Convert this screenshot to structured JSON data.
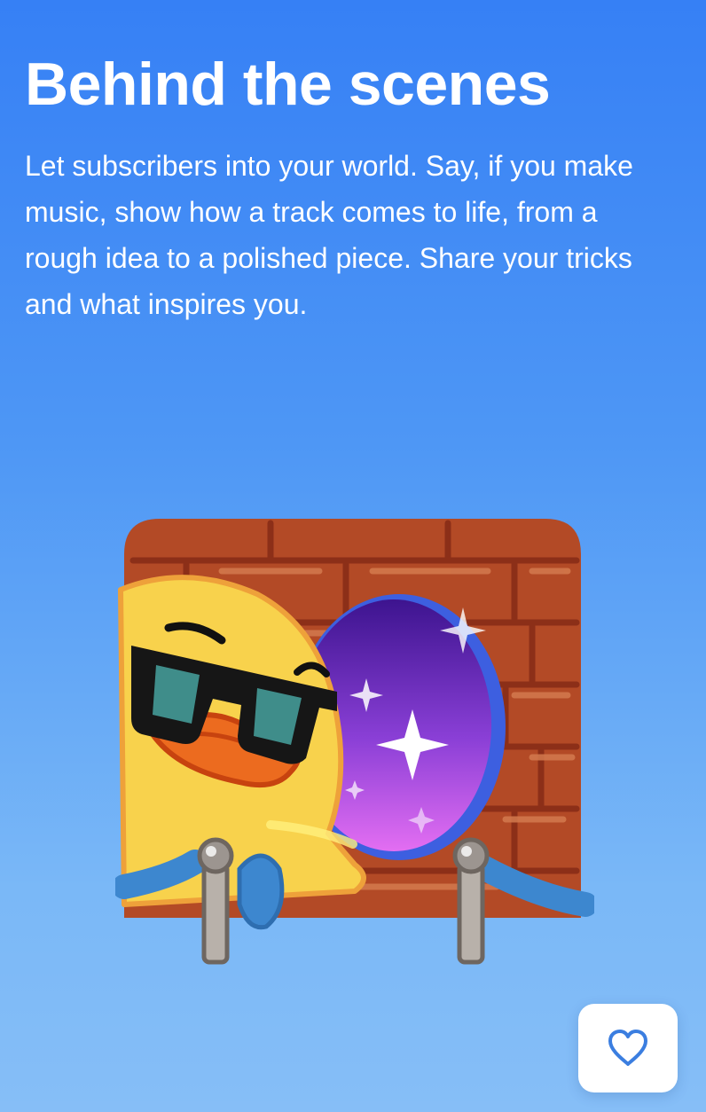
{
  "page": {
    "title": "Behind the scenes",
    "description": "Let subscribers into your world. Say, if you make music, show how a track comes to life, from a rough idea to a polished piece. Share your tricks and what inspires you."
  },
  "illustration": {
    "subject": "duck-sunglasses-brick-wall-portal-sticker"
  },
  "like_button": {
    "icon": "heart-outline-icon",
    "color": "#3b7ee0"
  },
  "colors": {
    "background_top": "#3680f5",
    "background_bottom": "#86bef7",
    "text": "#ffffff"
  }
}
